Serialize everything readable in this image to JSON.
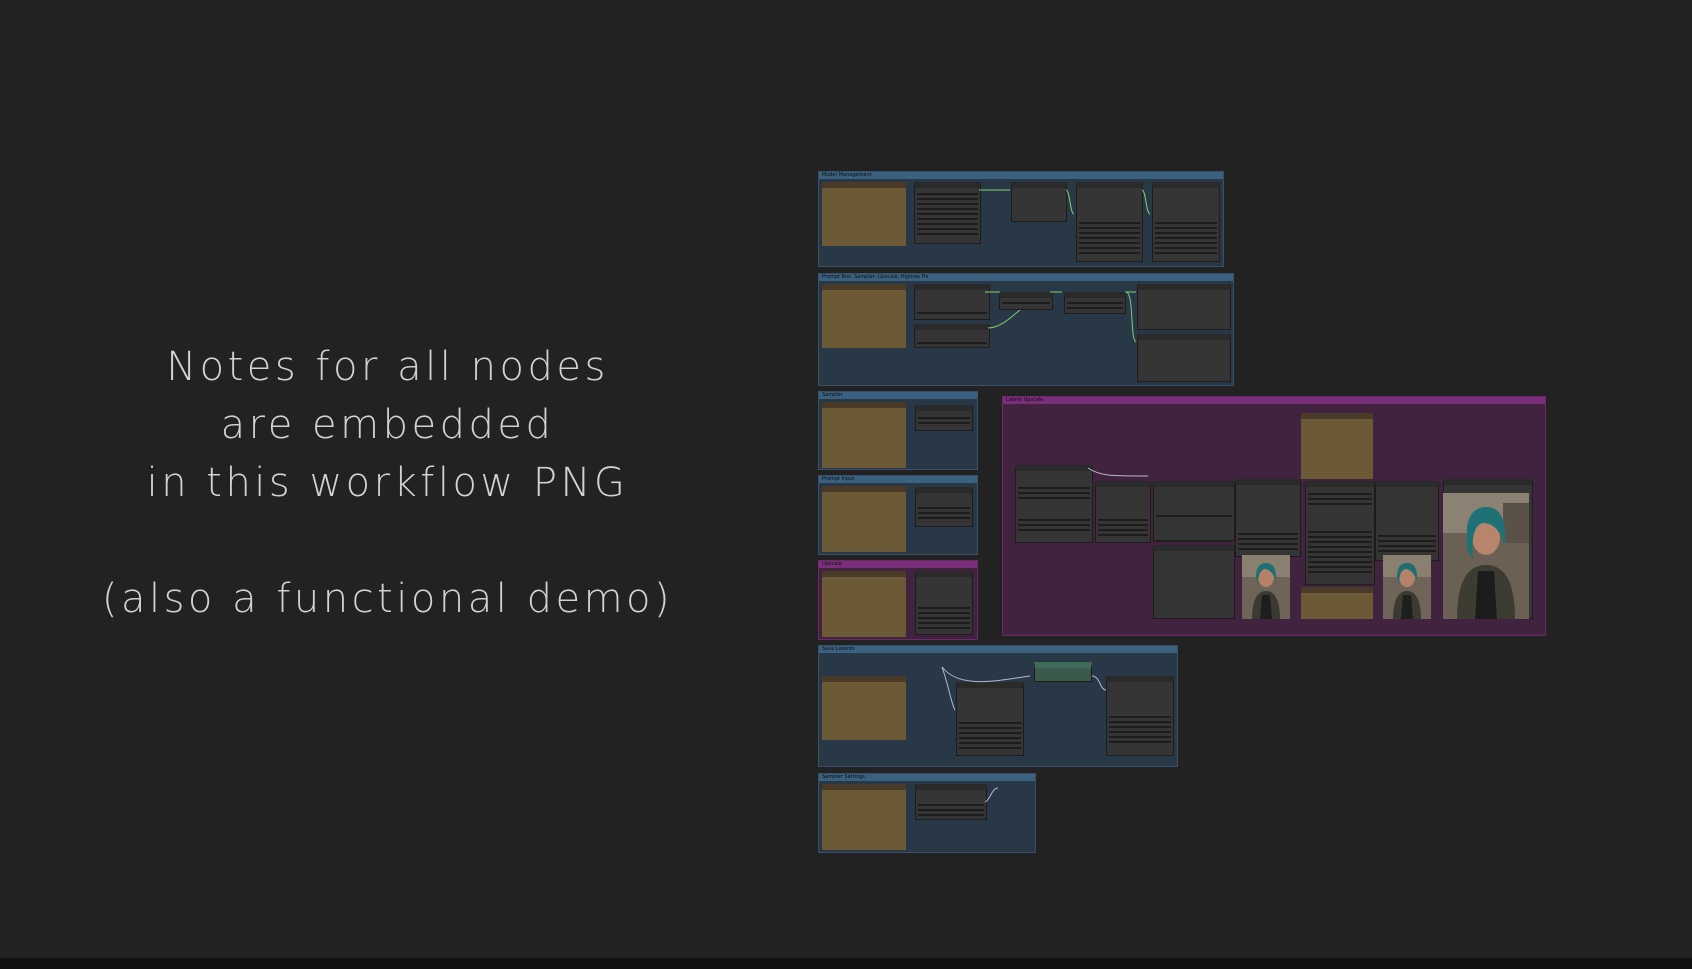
{
  "caption": {
    "line1": "Notes for all nodes",
    "line2": "are embedded",
    "line3": "in this workflow PNG",
    "line4": "(also a functional demo)"
  },
  "groups": {
    "g1": "Model Management",
    "g2": "Prompt Box, Sampler, Upscale, Highres Fix",
    "g3": "Sampler",
    "g4": "Prompt Input",
    "g5": "Upscale",
    "g6": "Latent Upscale",
    "g7": "Save Latents",
    "g8": "Sampler Settings"
  },
  "colors": {
    "background": "#222222",
    "caption_text": "#d2d2d2",
    "group_blue": "#293847",
    "group_purple": "#41223f",
    "note_node": "#6c5a36",
    "node": "#353535",
    "wire": "#7fcf6a"
  },
  "icons": {
    "portrait_1": "portrait-photo-icon",
    "portrait_2": "portrait-photo-icon",
    "portrait_large": "portrait-photo-icon"
  }
}
